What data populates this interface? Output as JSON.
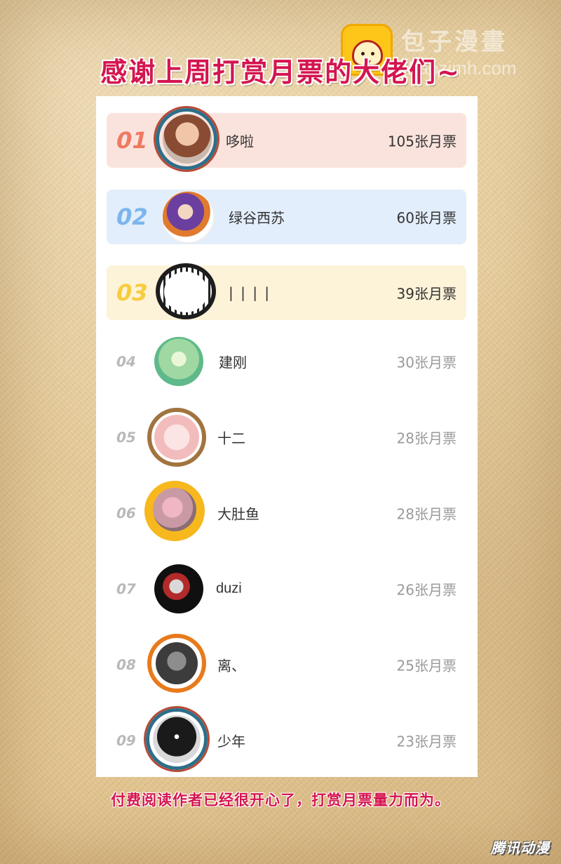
{
  "title": "感谢上周打赏月票的大佬们~",
  "logo": {
    "name": "包子漫畫",
    "domain": "baozimh.com"
  },
  "rows": [
    {
      "rank": "01",
      "name": "哆啦",
      "tickets": "105张月票"
    },
    {
      "rank": "02",
      "name": "绿谷西苏",
      "tickets": "60张月票"
    },
    {
      "rank": "03",
      "name": "| | | |",
      "tickets": "39张月票"
    },
    {
      "rank": "04",
      "name": "建刚",
      "tickets": "30张月票"
    },
    {
      "rank": "05",
      "name": "十二",
      "tickets": "28张月票"
    },
    {
      "rank": "06",
      "name": "大肚鱼",
      "tickets": "28张月票"
    },
    {
      "rank": "07",
      "name": "duzi",
      "tickets": "26张月票"
    },
    {
      "rank": "08",
      "name": "离、",
      "tickets": "25张月票"
    },
    {
      "rank": "09",
      "name": "少年",
      "tickets": "23张月票"
    }
  ],
  "footer": "付费阅读作者已经很开心了，打赏月票量力而为。",
  "watermark": "腾讯动漫",
  "colors": {
    "title": "#d4154f",
    "rank1": "#ee7a62",
    "rank2": "#7bb5ee",
    "rank3": "#f7cc3d",
    "rank_other": "#b9b9b9"
  },
  "avatar_icons": [
    "portrait-woman-icon",
    "anime-character-icon",
    "panda-frame-icon",
    "bamboo-icon",
    "bear-frame-icon",
    "blurred-photo-icon",
    "ultraman-icon",
    "penguin-frame-icon",
    "shadow-creature-icon"
  ]
}
